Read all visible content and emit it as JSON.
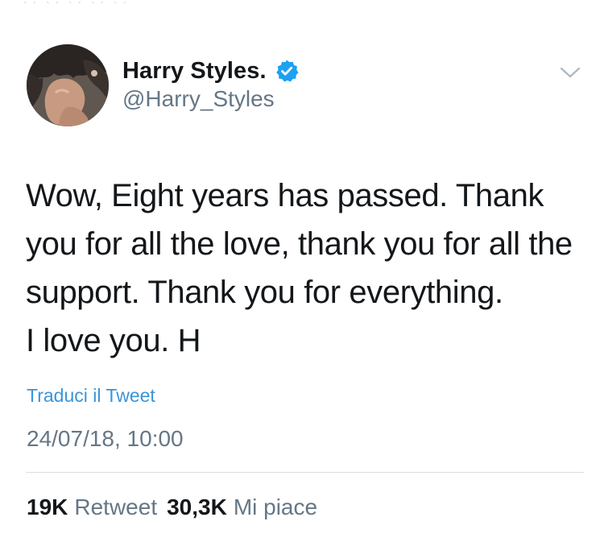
{
  "user": {
    "display_name": "Harry Styles.",
    "handle": "@Harry_Styles",
    "verified": true
  },
  "tweet": {
    "lines": [
      "Wow, Eight years has passed. Thank",
      "you for all the love, thank you for all the",
      "support. Thank you for everything.",
      "I love you. H"
    ],
    "translate_label": "Traduci il Tweet",
    "timestamp": "24/07/18, 10:00"
  },
  "stats": {
    "retweets_count": "19K",
    "retweets_label": "Retweet",
    "likes_count": "30,3K",
    "likes_label": "Mi piace"
  },
  "icons": {
    "verified": "verified-badge-icon",
    "menu": "chevron-down-icon"
  },
  "colors": {
    "link": "#3b94d9",
    "secondary_text": "#657786",
    "verified_badge": "#1da1f2",
    "primary_text": "#14171a"
  }
}
